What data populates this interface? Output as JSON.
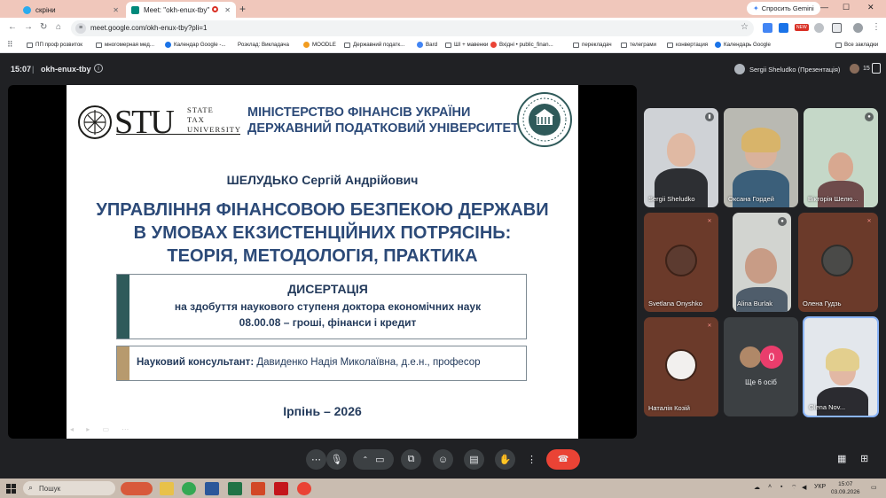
{
  "browser": {
    "tabs": [
      {
        "title": "скріни",
        "active": false
      },
      {
        "title": "Meet: \"okh-enux-tby\"",
        "active": true
      }
    ],
    "new_tab_icon": "plus-icon",
    "gemini_label": "Спросить Gemini",
    "url": "meet.google.com/okh-enux-tby?pli=1",
    "new_badge": "NEW",
    "bookmarks": [
      "ПП проф розвиток",
      "многомерная мед...",
      "Календар Google -...",
      "Розклад: Викладача",
      "MOODLE",
      "Державний податк...",
      "Bard",
      "ШІ + мавенки",
      "Вхідні • public_finan...",
      "перекладач",
      "телеграми",
      "конвертация",
      "Календарь Google"
    ],
    "all_bookmarks": "Все закладки"
  },
  "meet": {
    "time": "15:07",
    "separator": "|",
    "meeting_code": "okh-enux-tby",
    "presenter": "Sergii Sheludko (Презентація)",
    "participant_count": "15"
  },
  "slide": {
    "stu_big": "STU",
    "stu_small": [
      "STATE",
      "TAX",
      "UNIVERSITY"
    ],
    "ministry": [
      "МІНІСТЕРСТВО ФІНАНСІВ УКРАЇНИ",
      "ДЕРЖАВНИЙ ПОДАТКОВИЙ УНІВЕРСИТЕТ"
    ],
    "author": "ШЕЛУДЬКО Сергій Андрійович",
    "title": [
      "УПРАВЛІННЯ ФІНАНСОВОЮ БЕЗПЕКОЮ ДЕРЖАВИ",
      "В УМОВАХ ЕКЗИСТЕНЦІЙНИХ ПОТРЯСІНЬ:",
      "ТЕОРІЯ, МЕТОДОЛОГІЯ, ПРАКТИКА"
    ],
    "dissertation": [
      "ДИСЕРТАЦІЯ",
      "на здобуття наукового ступеня доктора економічних наук",
      "08.00.08 – гроші, фінанси і кредит"
    ],
    "consultant_label": "Науковий консультант:",
    "consultant_name": " Давиденко Надія Миколаївна, д.е.н., професор",
    "city_year": "Ірпінь – 2026",
    "accent_colors": {
      "title": "#2c4a78",
      "bar_dark": "#2f5a5a",
      "bar_gold": "#b79a6e"
    }
  },
  "participants": [
    {
      "name": "Sergii Sheludko",
      "mic": "speaking"
    },
    {
      "name": "Оксана Гордей",
      "mic": "none"
    },
    {
      "name": "Вікторія Шелю...",
      "mic": "on"
    },
    {
      "name": "Svetlana Onyshko",
      "mic": "muted"
    },
    {
      "name": "Alina Burlak",
      "mic": "on"
    },
    {
      "name": "Олена Гудзь",
      "mic": "muted"
    },
    {
      "name": "Наталія Козій",
      "mic": "muted"
    },
    {
      "name": "Olena Nov...",
      "mic": "none"
    }
  ],
  "more": {
    "count": "0",
    "label": "Ще 6 осіб"
  },
  "controls": {
    "more_options": "⋯",
    "mic_icon": "microphone-icon",
    "camera_icon": "camera-icon",
    "present_icon": "present-screen-icon",
    "emoji_icon": "emoji-icon",
    "captions_icon": "captions-icon",
    "hand_icon": "raise-hand-icon",
    "end_icon": "end-call-icon"
  },
  "taskbar": {
    "search_placeholder": "Пошук",
    "lang": "УКР",
    "time": "15:07",
    "date": "03.09.2026"
  }
}
